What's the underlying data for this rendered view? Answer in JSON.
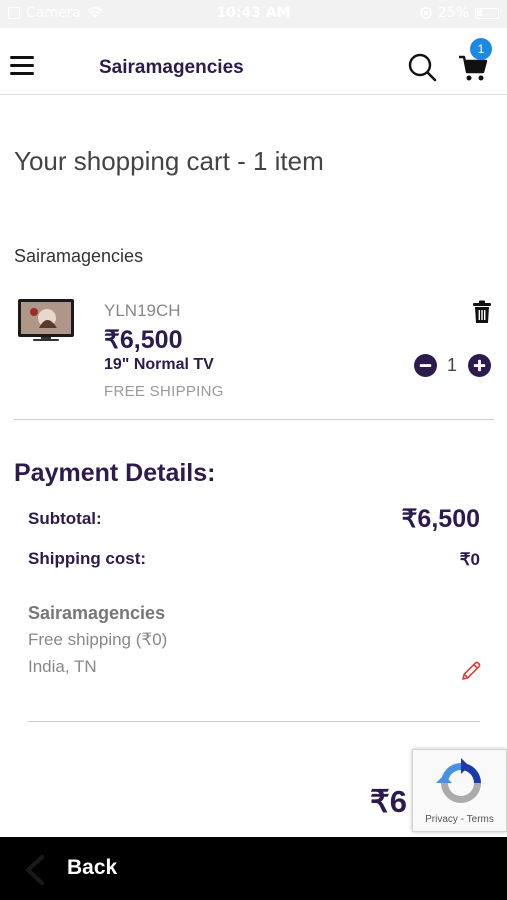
{
  "status_bar": {
    "carrier": "Camera",
    "time": "10:43 AM",
    "battery": "25%"
  },
  "header": {
    "brand": "Sairamagencies",
    "cart_count": "1"
  },
  "cart": {
    "title": "Your shopping cart - 1 item",
    "seller": "Sairamagencies",
    "items": [
      {
        "sku": "YLN19CH",
        "price": "₹6,500",
        "name": "19\" Normal TV",
        "shipping": "FREE SHIPPING",
        "quantity": "1"
      }
    ]
  },
  "payment": {
    "heading": "Payment Details:",
    "subtotal_label": "Subtotal:",
    "subtotal_value": "₹6,500",
    "shipping_label": "Shipping cost:",
    "shipping_value": "₹0",
    "shipping_seller": "Sairamagencies",
    "shipping_method": "Free shipping (₹0)",
    "shipping_location": "India, TN",
    "total_value": "₹6"
  },
  "recaptcha": {
    "links": "Privacy - Terms"
  },
  "footer": {
    "back_label": "Back"
  },
  "colors": {
    "brand": "#2d1b4e",
    "badge": "#1e88e5",
    "edit": "#e53935"
  },
  "icons": [
    "menu-icon",
    "search-icon",
    "cart-icon",
    "trash-icon",
    "minus-circle-icon",
    "plus-circle-icon",
    "pencil-icon",
    "recaptcha-icon",
    "chevron-left-icon"
  ]
}
